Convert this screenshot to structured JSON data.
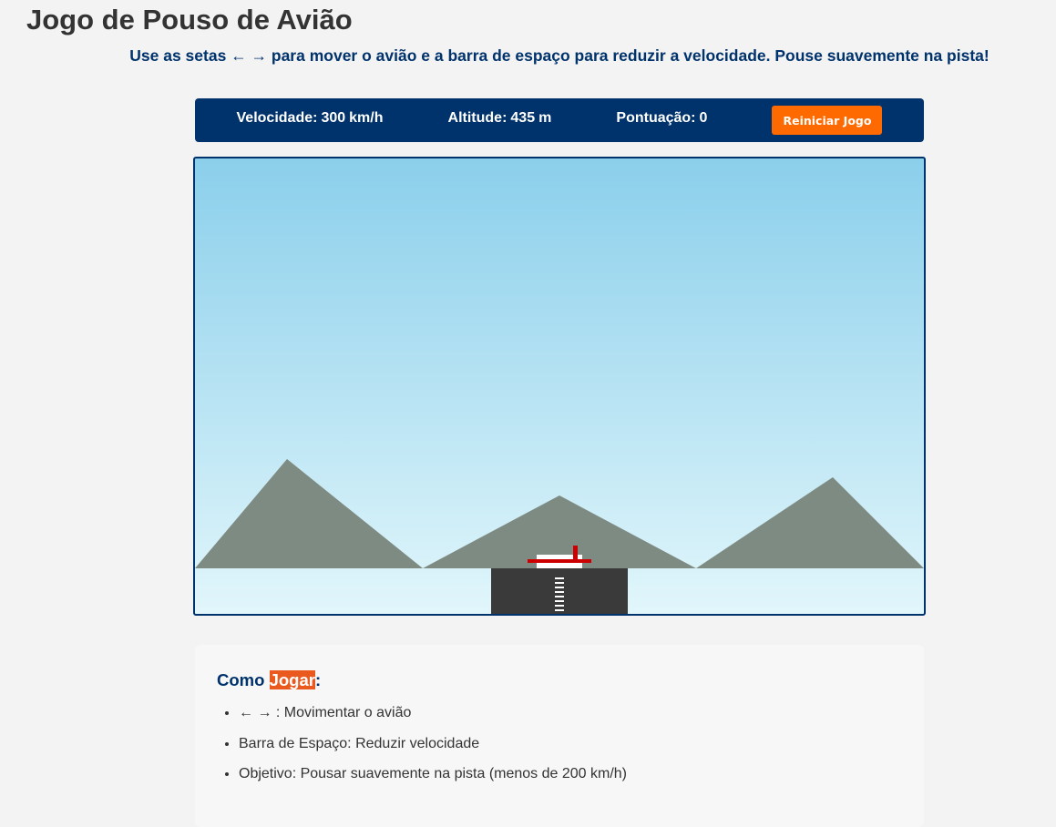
{
  "page": {
    "title": "Jogo de Pouso de Avião",
    "subtitle": "Use as setas ← → para mover o avião e a barra de espaço para reduzir a velocidade. Pouse suavemente na pista!"
  },
  "status": {
    "speed_label": "Velocidade:",
    "speed_value": "300",
    "speed_unit": "km/h",
    "altitude_label": "Altitude:",
    "altitude_value": "435",
    "altitude_unit": "m",
    "score_label": "Pontuação:",
    "score_value": "0",
    "restart_label": "Reiniciar Jogo"
  },
  "colors": {
    "header_blue": "#00326b",
    "button_orange": "#ff6a00",
    "sky_top": "#8bcfeb",
    "sky_bottom": "#e1f6fb",
    "mountain": "#7e8b82",
    "runway": "#3a3a3a",
    "plane_red": "#cc0000",
    "highlight": "#ea5a1e"
  },
  "instructions": {
    "title_prefix": "Como ",
    "title_highlight": "Jogar",
    "title_suffix": ":",
    "items": [
      "← → : Movimentar o avião",
      "Barra de Espaço: Reduzir velocidade",
      "Objetivo: Pousar suavemente na pista (menos de 200 km/h)"
    ]
  }
}
